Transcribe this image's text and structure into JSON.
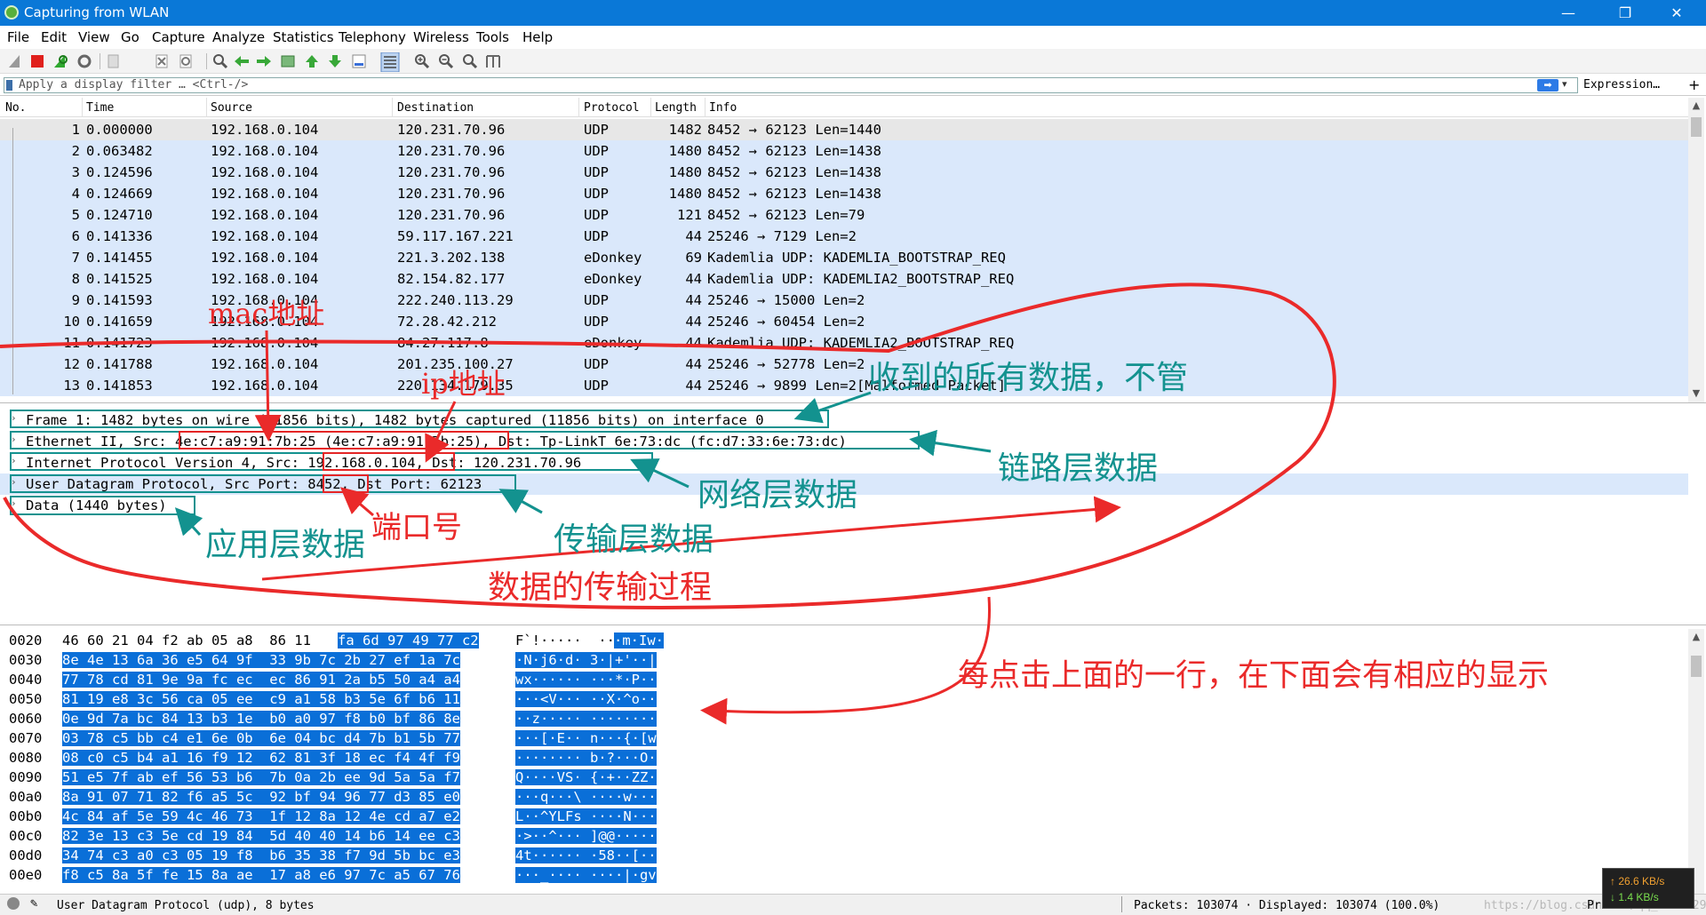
{
  "window": {
    "title": "Capturing from WLAN",
    "minimize_glyph": "—",
    "restore_glyph": "❐",
    "close_glyph": "✕"
  },
  "menu": [
    "File",
    "Edit",
    "View",
    "Go",
    "Capture",
    "Analyze",
    "Statistics",
    "Telephony",
    "Wireless",
    "Tools",
    "Help"
  ],
  "toolbar_icons": [
    "shark-fin-start-icon",
    "stop-capture-icon",
    "restart-capture-icon",
    "capture-options-icon",
    "open-file-icon",
    "close-file-icon",
    "reload-file-icon",
    "find-packet-icon",
    "go-back-icon",
    "go-forward-icon",
    "go-to-packet-icon",
    "go-first-icon",
    "go-last-icon",
    "autoscroll-icon",
    "colorize-icon",
    "zoom-in-icon",
    "zoom-out-icon",
    "normal-size-icon",
    "resize-columns-icon"
  ],
  "filter": {
    "placeholder": "Apply a display filter … <Ctrl-/>",
    "apply_glyph": "➡",
    "dropdown_glyph": "▾",
    "expression_label": "Expression…",
    "add_glyph": "+"
  },
  "packet_list": {
    "columns": {
      "no": "No.",
      "time": "Time",
      "source": "Source",
      "destination": "Destination",
      "protocol": "Protocol",
      "length": "Length",
      "info": "Info"
    },
    "rows": [
      {
        "no": "1",
        "time": "0.000000",
        "src": "192.168.0.104",
        "dst": "120.231.70.96",
        "proto": "UDP",
        "len": "1482",
        "info": "8452 → 62123 Len=1440"
      },
      {
        "no": "2",
        "time": "0.063482",
        "src": "192.168.0.104",
        "dst": "120.231.70.96",
        "proto": "UDP",
        "len": "1480",
        "info": "8452 → 62123 Len=1438"
      },
      {
        "no": "3",
        "time": "0.124596",
        "src": "192.168.0.104",
        "dst": "120.231.70.96",
        "proto": "UDP",
        "len": "1480",
        "info": "8452 → 62123 Len=1438"
      },
      {
        "no": "4",
        "time": "0.124669",
        "src": "192.168.0.104",
        "dst": "120.231.70.96",
        "proto": "UDP",
        "len": "1480",
        "info": "8452 → 62123 Len=1438"
      },
      {
        "no": "5",
        "time": "0.124710",
        "src": "192.168.0.104",
        "dst": "120.231.70.96",
        "proto": "UDP",
        "len": "121",
        "info": "8452 → 62123 Len=79"
      },
      {
        "no": "6",
        "time": "0.141336",
        "src": "192.168.0.104",
        "dst": "59.117.167.221",
        "proto": "UDP",
        "len": "44",
        "info": "25246 → 7129 Len=2"
      },
      {
        "no": "7",
        "time": "0.141455",
        "src": "192.168.0.104",
        "dst": "221.3.202.138",
        "proto": "eDonkey",
        "len": "69",
        "info": "Kademlia UDP: KADEMLIA_BOOTSTRAP_REQ"
      },
      {
        "no": "8",
        "time": "0.141525",
        "src": "192.168.0.104",
        "dst": "82.154.82.177",
        "proto": "eDonkey",
        "len": "44",
        "info": "Kademlia UDP: KADEMLIA2_BOOTSTRAP_REQ"
      },
      {
        "no": "9",
        "time": "0.141593",
        "src": "192.168.0.104",
        "dst": "222.240.113.29",
        "proto": "UDP",
        "len": "44",
        "info": "25246 → 15000 Len=2"
      },
      {
        "no": "10",
        "time": "0.141659",
        "src": "192.168.0.104",
        "dst": "72.28.42.212",
        "proto": "UDP",
        "len": "44",
        "info": "25246 → 60454 Len=2"
      },
      {
        "no": "11",
        "time": "0.141723",
        "src": "192.168.0.104",
        "dst": "84.27.117.8",
        "proto": "eDonkey",
        "len": "44",
        "info": "Kademlia UDP: KADEMLIA2_BOOTSTRAP_REQ"
      },
      {
        "no": "12",
        "time": "0.141788",
        "src": "192.168.0.104",
        "dst": "201.235.100.27",
        "proto": "UDP",
        "len": "44",
        "info": "25246 → 52778 Len=2"
      },
      {
        "no": "13",
        "time": "0.141853",
        "src": "192.168.0.104",
        "dst": "220.134.179.35",
        "proto": "UDP",
        "len": "44",
        "info": "25246 → 9899 Len=2[Malformed Packet]"
      }
    ]
  },
  "details": [
    {
      "expander": "›",
      "text": "Frame 1: 1482 bytes on wire (11856 bits), 1482 bytes captured (11856 bits) on interface 0"
    },
    {
      "expander": "›",
      "text": "Ethernet II, Src: 4e:c7:a9:91:7b:25 (4e:c7:a9:91:7b:25), Dst: Tp-LinkT_6e:73:dc (fc:d7:33:6e:73:dc)"
    },
    {
      "expander": "›",
      "text": "Internet Protocol Version 4, Src: 192.168.0.104, Dst: 120.231.70.96"
    },
    {
      "expander": "›",
      "text": "User Datagram Protocol, Src Port: 8452, Dst Port: 62123"
    },
    {
      "expander": "›",
      "text": "Data (1440 bytes)"
    }
  ],
  "bytes": [
    {
      "offset": "0020",
      "hex_a": "46 60 21 04 f2 ab 05 a8  86 11",
      "hex_b": "fa 6d 97 49 77 c2",
      "ascii_a": "F`!·····  ··",
      "ascii_b": "·m·Iw·"
    },
    {
      "offset": "0030",
      "hex_a": "",
      "hex_b": "8e 4e 13 6a 36 e5 64 9f  33 9b 7c 2b 27 ef 1a 7c",
      "ascii_a": "",
      "ascii_b": "·N·j6·d· 3·|+'··|"
    },
    {
      "offset": "0040",
      "hex_a": "",
      "hex_b": "77 78 cd 81 9e 9a fc ec  ec 86 91 2a b5 50 a4 a4",
      "ascii_a": "",
      "ascii_b": "wx······ ···*·P··"
    },
    {
      "offset": "0050",
      "hex_a": "",
      "hex_b": "81 19 e8 3c 56 ca 05 ee  c9 a1 58 b3 5e 6f b6 11",
      "ascii_a": "",
      "ascii_b": "···<V··· ··X·^o··"
    },
    {
      "offset": "0060",
      "hex_a": "",
      "hex_b": "0e 9d 7a bc 84 13 b3 1e  b0 a0 97 f8 b0 bf 86 8e",
      "ascii_a": "",
      "ascii_b": "··z····· ········"
    },
    {
      "offset": "0070",
      "hex_a": "",
      "hex_b": "03 78 c5 bb c4 e1 6e 0b  6e 04 bc d4 7b b1 5b 77",
      "ascii_a": "",
      "ascii_b": "···[·E·· n···{·[w"
    },
    {
      "offset": "0080",
      "hex_a": "",
      "hex_b": "08 c0 c5 b4 a1 16 f9 12  62 81 3f 18 ec f4 4f f9",
      "ascii_a": "",
      "ascii_b": "········ b·?···O·"
    },
    {
      "offset": "0090",
      "hex_a": "",
      "hex_b": "51 e5 7f ab ef 56 53 b6  7b 0a 2b ee 9d 5a 5a f7",
      "ascii_a": "",
      "ascii_b": "Q····VS· {·+··ZZ·"
    },
    {
      "offset": "00a0",
      "hex_a": "",
      "hex_b": "8a 91 07 71 82 f6 a5 5c  92 bf 94 96 77 d3 85 e0",
      "ascii_a": "",
      "ascii_b": "···q···\\ ····w···"
    },
    {
      "offset": "00b0",
      "hex_a": "",
      "hex_b": "4c 84 af 5e 59 4c 46 73  1f 12 8a 12 4e cd a7 e2",
      "ascii_a": "",
      "ascii_b": "L··^YLFs ····N···"
    },
    {
      "offset": "00c0",
      "hex_a": "",
      "hex_b": "82 3e 13 c3 5e cd 19 84  5d 40 40 14 b6 14 ee c3",
      "ascii_a": "",
      "ascii_b": "·>··^··· ]@@·····"
    },
    {
      "offset": "00d0",
      "hex_a": "",
      "hex_b": "34 74 c3 a0 c3 05 19 f8  b6 35 38 f7 9d 5b bc e3",
      "ascii_a": "",
      "ascii_b": "4t······ ·58··[··"
    },
    {
      "offset": "00e0",
      "hex_a": "",
      "hex_b": "f8 c5 8a 5f fe 15 8a ae  17 a8 e6 97 7c a5 67 76",
      "ascii_a": "",
      "ascii_b": "···_···· ····|·gv"
    }
  ],
  "status": {
    "field": "User Datagram Protocol (udp), 8 bytes",
    "packets": "Packets: 103074 · Displayed: 103074 (100.0%)",
    "profile": "Pr",
    "watermark": "https://blog.csdn.net/qq_34873298"
  },
  "speed": {
    "up": "↑ 26.6 KB/s",
    "down": "↓ 1.4 KB/s"
  },
  "annotations": {
    "mac": "mac地址",
    "ip": "ip地址",
    "ignore": "收到的所有数据，不管",
    "link": "链路层数据",
    "network": "网络层数据",
    "port": "端口号",
    "transport": "传输层数据",
    "app": "应用层数据",
    "process": "数据的传输过程",
    "hint": "每点击上面的一行，在下面会有相应的显示"
  },
  "colors": {
    "teal": "#13928f",
    "red": "#ea2a2a",
    "selection": "#0a6fd8",
    "row_bg": "#dae8fb",
    "titlebar": "#0a78d7"
  }
}
